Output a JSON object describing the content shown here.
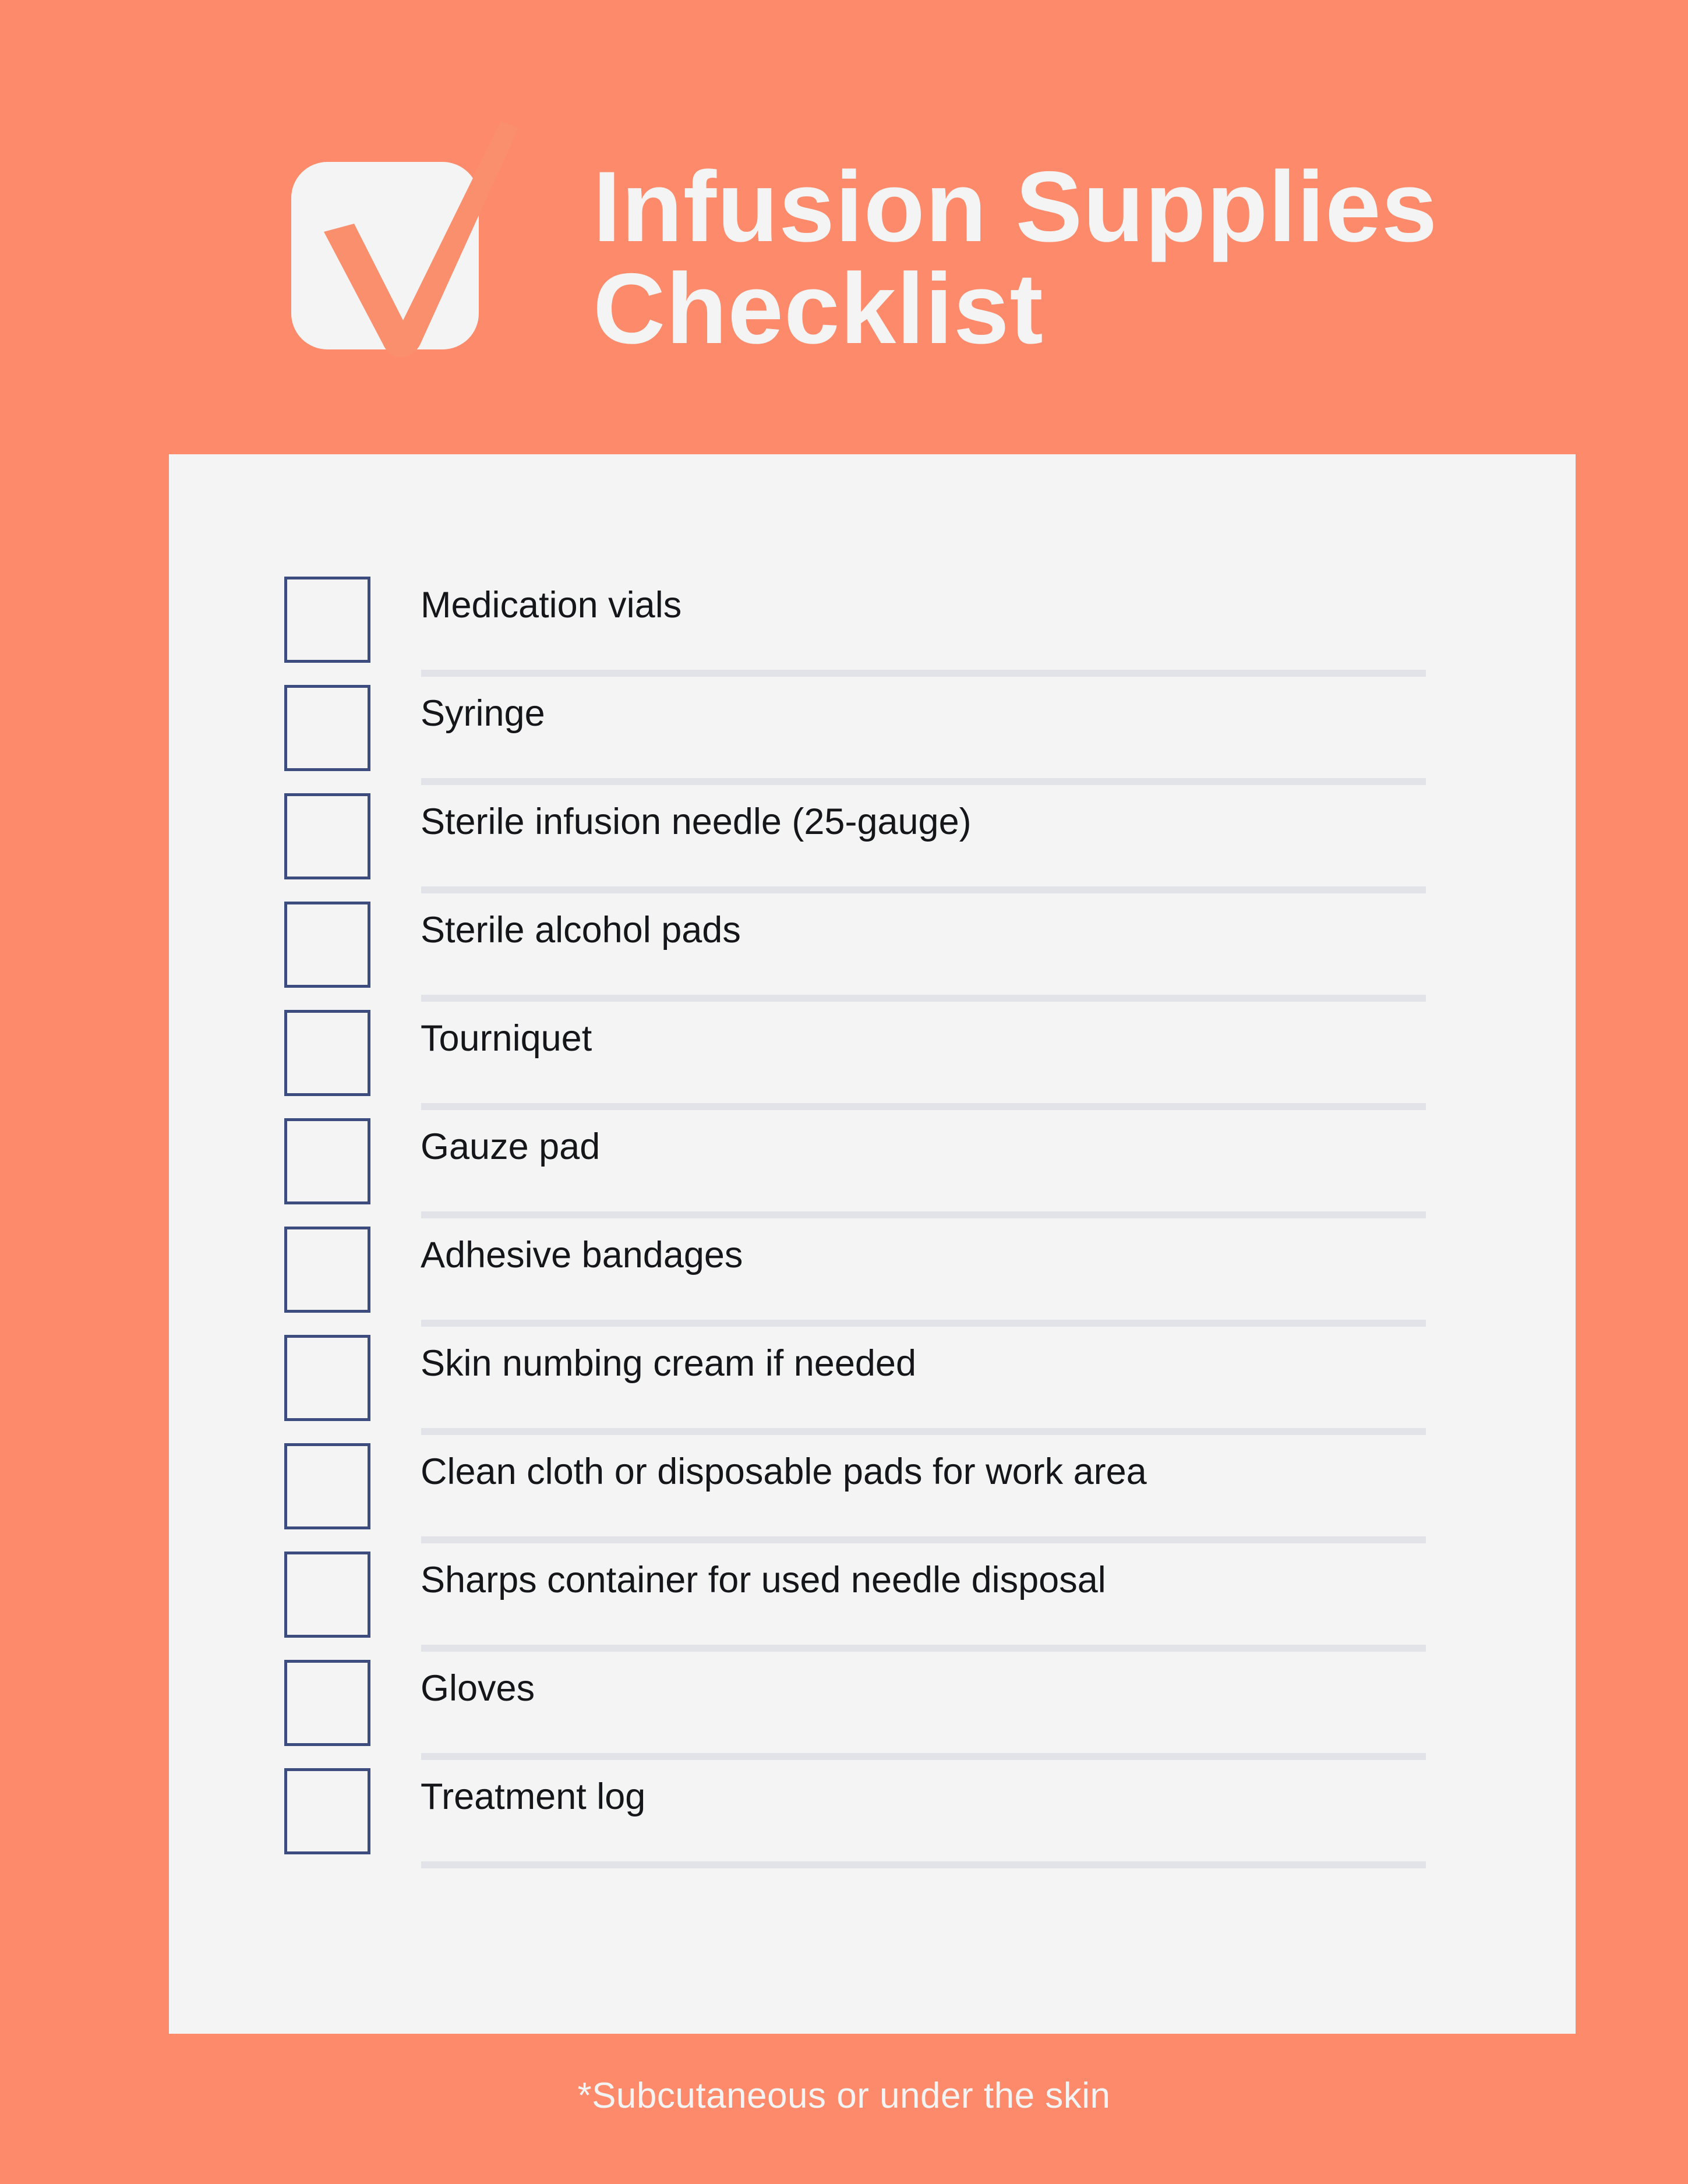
{
  "theme": {
    "background_color": "#fd8b6b",
    "card_color": "#f4f4f4",
    "checkbox_border_color": "#3d4c7e",
    "divider_color": "#e2e3e9",
    "title_color": "#f4f4f4",
    "item_text_color": "#15161a"
  },
  "header": {
    "logo_icon": "checkmark-box-icon",
    "title_lines": [
      "Infusion Supplies",
      "Checklist"
    ]
  },
  "checklist": {
    "items": [
      {
        "label": "Medication vials",
        "checked": false
      },
      {
        "label": "Syringe",
        "checked": false
      },
      {
        "label": "Sterile infusion needle (25-gauge)",
        "checked": false
      },
      {
        "label": "Sterile alcohol pads",
        "checked": false
      },
      {
        "label": "Tourniquet",
        "checked": false
      },
      {
        "label": "Gauze pad",
        "checked": false
      },
      {
        "label": "Adhesive bandages",
        "checked": false
      },
      {
        "label": "Skin numbing cream if needed",
        "checked": false
      },
      {
        "label": "Clean cloth or disposable pads for work area",
        "checked": false
      },
      {
        "label": "Sharps container for used needle disposal",
        "checked": false
      },
      {
        "label": "Gloves",
        "checked": false
      },
      {
        "label": "Treatment log",
        "checked": false
      }
    ]
  },
  "footer": {
    "note": "*Subcutaneous or under the skin"
  }
}
